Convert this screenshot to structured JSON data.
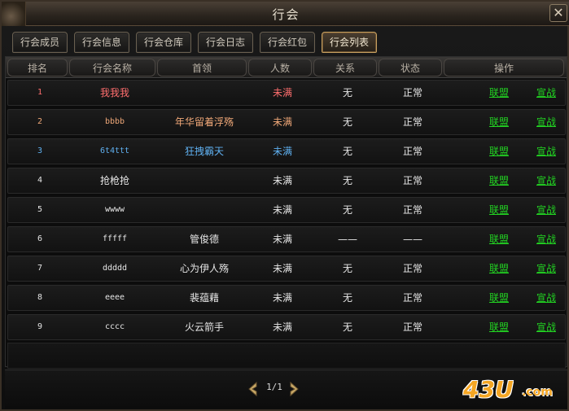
{
  "window": {
    "title": "行会",
    "close_label": "✕"
  },
  "tabs": [
    {
      "label": "行会成员"
    },
    {
      "label": "行会信息"
    },
    {
      "label": "行会仓库"
    },
    {
      "label": "行会日志"
    },
    {
      "label": "行会红包"
    },
    {
      "label": "行会列表"
    }
  ],
  "active_tab": "行会列表",
  "table": {
    "headers": [
      "排名",
      "行会名称",
      "首领",
      "人数",
      "关系",
      "状态",
      "操作"
    ],
    "rows": [
      {
        "rank": "1",
        "name": "我我我",
        "leader": "",
        "count": "未满",
        "relation": "无",
        "status": "正常",
        "ally": "联盟",
        "war": "宣战",
        "rank_color": "#ff6e6e",
        "name_color": "#ff6e6e",
        "leader_color": "#ff6e6e",
        "count_color": "#ff6e6e"
      },
      {
        "rank": "2",
        "name": "bbbb",
        "leader": "年华留着浮殇",
        "count": "未满",
        "relation": "无",
        "status": "正常",
        "ally": "联盟",
        "war": "宣战",
        "rank_color": "#f0a878",
        "name_color": "#f0a878",
        "leader_color": "#f0a878",
        "count_color": "#f0a878"
      },
      {
        "rank": "3",
        "name": "6t4ttt",
        "leader": "狂拽霸天",
        "count": "未满",
        "relation": "无",
        "status": "正常",
        "ally": "联盟",
        "war": "宣战",
        "rank_color": "#5fb0f0",
        "name_color": "#5fb0f0",
        "leader_color": "#5fb0f0",
        "count_color": "#5fb0f0"
      },
      {
        "rank": "4",
        "name": "抢枪抢",
        "leader": "",
        "count": "未满",
        "relation": "无",
        "status": "正常",
        "ally": "联盟",
        "war": "宣战",
        "rank_color": "#e6e6e6",
        "name_color": "#e6e6e6",
        "leader_color": "#e6e6e6",
        "count_color": "#e6e6e6"
      },
      {
        "rank": "5",
        "name": "wwww",
        "leader": "",
        "count": "未满",
        "relation": "无",
        "status": "正常",
        "ally": "联盟",
        "war": "宣战",
        "rank_color": "#e6e6e6",
        "name_color": "#e6e6e6",
        "leader_color": "#e6e6e6",
        "count_color": "#e6e6e6"
      },
      {
        "rank": "6",
        "name": "fffff",
        "leader": "管俊德",
        "count": "未满",
        "relation": "——",
        "status": "——",
        "ally": "联盟",
        "war": "宣战",
        "rank_color": "#e6e6e6",
        "name_color": "#e6e6e6",
        "leader_color": "#e6e6e6",
        "count_color": "#e6e6e6"
      },
      {
        "rank": "7",
        "name": "ddddd",
        "leader": "心为伊人殇",
        "count": "未满",
        "relation": "无",
        "status": "正常",
        "ally": "联盟",
        "war": "宣战",
        "rank_color": "#e6e6e6",
        "name_color": "#e6e6e6",
        "leader_color": "#e6e6e6",
        "count_color": "#e6e6e6"
      },
      {
        "rank": "8",
        "name": "eeee",
        "leader": "裴蕴藉",
        "count": "未满",
        "relation": "无",
        "status": "正常",
        "ally": "联盟",
        "war": "宣战",
        "rank_color": "#e6e6e6",
        "name_color": "#e6e6e6",
        "leader_color": "#e6e6e6",
        "count_color": "#e6e6e6"
      },
      {
        "rank": "9",
        "name": "cccc",
        "leader": "火云箭手",
        "count": "未满",
        "relation": "无",
        "status": "正常",
        "ally": "联盟",
        "war": "宣战",
        "rank_color": "#e6e6e6",
        "name_color": "#e6e6e6",
        "leader_color": "#e6e6e6",
        "count_color": "#e6e6e6"
      }
    ]
  },
  "pager": {
    "text": "1/1",
    "prev_icon": "arrow-left-icon",
    "next_icon": "arrow-right-icon"
  },
  "watermark": {
    "text": "43U",
    "suffix": ".com"
  },
  "colors": {
    "link": "#22d422",
    "accent_border": "#c6a060"
  }
}
